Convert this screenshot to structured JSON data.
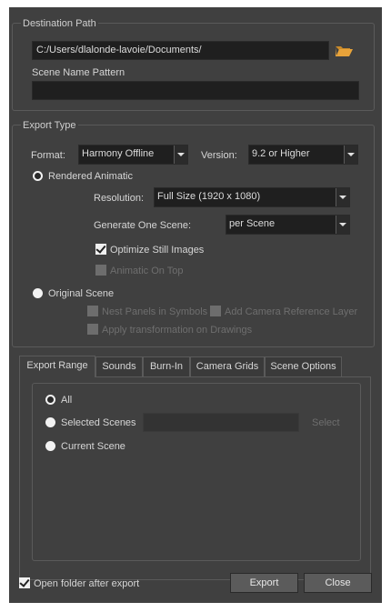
{
  "destination": {
    "title": "Destination Path",
    "path_value": "C:/Users/dlalonde-lavoie/Documents/",
    "scene_name_label": "Scene Name Pattern",
    "scene_name_value": ""
  },
  "export_type": {
    "title": "Export Type",
    "format_label": "Format:",
    "format_value": "Harmony Offline",
    "version_label": "Version:",
    "version_value": "9.2 or Higher",
    "rendered_animatic_label": "Rendered Animatic",
    "resolution_label": "Resolution:",
    "resolution_value": "Full Size (1920 x 1080)",
    "generate_label": "Generate One Scene:",
    "generate_value": "per Scene",
    "optimize_label": "Optimize Still Images",
    "animatic_on_top_label": "Animatic On Top",
    "original_scene_label": "Original Scene",
    "nest_panels_label": "Nest Panels in Symbols",
    "add_camera_label": "Add Camera Reference Layer",
    "apply_transform_label": "Apply transformation on Drawings"
  },
  "tabs": [
    "Export Range",
    "Sounds",
    "Burn-In",
    "Camera Grids",
    "Scene Options"
  ],
  "export_range": {
    "all_label": "All",
    "selected_scenes_label": "Selected Scenes",
    "selected_scenes_value": "",
    "select_button": "Select",
    "current_scene_label": "Current Scene"
  },
  "footer": {
    "open_folder_label": "Open folder after export",
    "export_button": "Export",
    "close_button": "Close"
  },
  "colors": {
    "dialog_bg": "#404040",
    "field_bg": "#1f1f1f",
    "button_bg": "#5b5b5b",
    "folder_icon": "#e8a33a"
  },
  "icons": [
    "folder-open-icon"
  ]
}
